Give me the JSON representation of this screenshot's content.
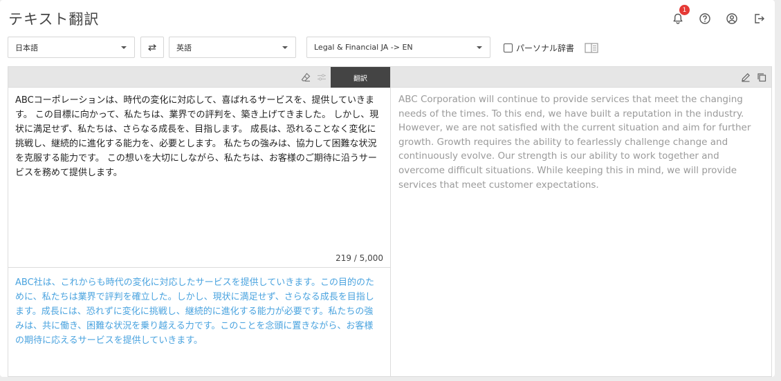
{
  "app": {
    "title": "テキスト翻訳",
    "notification_count": "1"
  },
  "header_icons": [
    "bell-icon",
    "help-icon",
    "account-icon",
    "logout-icon"
  ],
  "toolbar": {
    "source_lang": "日本語",
    "target_lang": "英語",
    "model": "Legal & Financial JA -> EN",
    "personal_dictionary_label": "パーソナル辞書",
    "personal_dictionary_checked": false
  },
  "left_panel": {
    "translate_button": "翻訳",
    "source_text": "ABCコーポレーションは、時代の変化に対応して、喜ばれるサービスを、提供していきます。 この目標に向かって、私たちは、業界での評判を、築き上げてきました。 しかし、現状に満足せず、私たちは、さらなる成長を、目指します。 成長は、恐れることなく変化に挑戦し、継続的に進化する能力を、必要とします。 私たちの強みは、協力して困難な状況を克服する能力です。 この想いを大切にしながら、私たちは、お客様のご期待に沿うサービスを務めて提供します。",
    "char_count": "219 / 5,000",
    "back_translation": "ABC社は、これからも時代の変化に対応したサービスを提供していきます。この目的のために、私たちは業界で評判を確立した。しかし、現状に満足せず、さらなる成長を目指します。成長には、恐れずに変化に挑戦し、継続的に進化する能力が必要です。私たちの強みは、共に働き、困難な状況を乗り越える力です。このことを念頭に置きながら、お客様の期待に応えるサービスを提供していきます。"
  },
  "right_panel": {
    "translated_text": "ABC Corporation will continue to provide services that meet the changing needs of the times. To this end, we have built a reputation in the industry. However, we are not satisfied with the current situation and aim for further growth. Growth requires the ability to fearlessly challenge change and continuously evolve. Our strength is our ability to work together and overcome difficult situations. While keeping this in mind, we will provide services that meet customer expectations."
  },
  "colors": {
    "back_translation": "#4aa3df",
    "translated_text": "#9a9a9a",
    "translate_button_bg": "#444444",
    "badge": "#e53935"
  }
}
